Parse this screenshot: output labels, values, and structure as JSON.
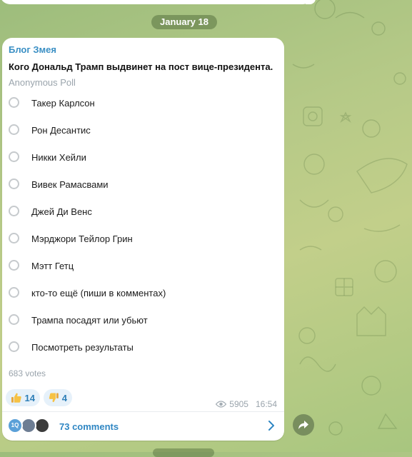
{
  "date_separator": "January 18",
  "post": {
    "channel_name": "Блог Змея",
    "poll": {
      "question": "Кого Дональд Трамп выдвинет на пост вице-президента.",
      "type_label": "Anonymous Poll",
      "options": [
        "Такер Карлсон",
        "Рон Десантис",
        "Никки Хейли",
        "Вивек Рамасвами",
        "Джей Ди Венс",
        "Мэрджори Тейлор Грин",
        "Мэтт Гетц",
        "кто-то ещё (пиши в комментах)",
        "Трампа посадят или убьют",
        "Посмотреть результаты"
      ],
      "votes_label": "683 votes"
    },
    "reactions": [
      {
        "emoji": "thumbs-up-icon",
        "count": "14"
      },
      {
        "emoji": "thumbs-down-icon",
        "count": "4"
      }
    ],
    "views": "5905",
    "time": "16:54",
    "comments": {
      "avatar_initials": "1Q",
      "label": "73 comments"
    }
  },
  "colors": {
    "accent": "#3a8fc4",
    "reaction_bg": "#e6f1fa",
    "muted": "#9aa4ac"
  }
}
